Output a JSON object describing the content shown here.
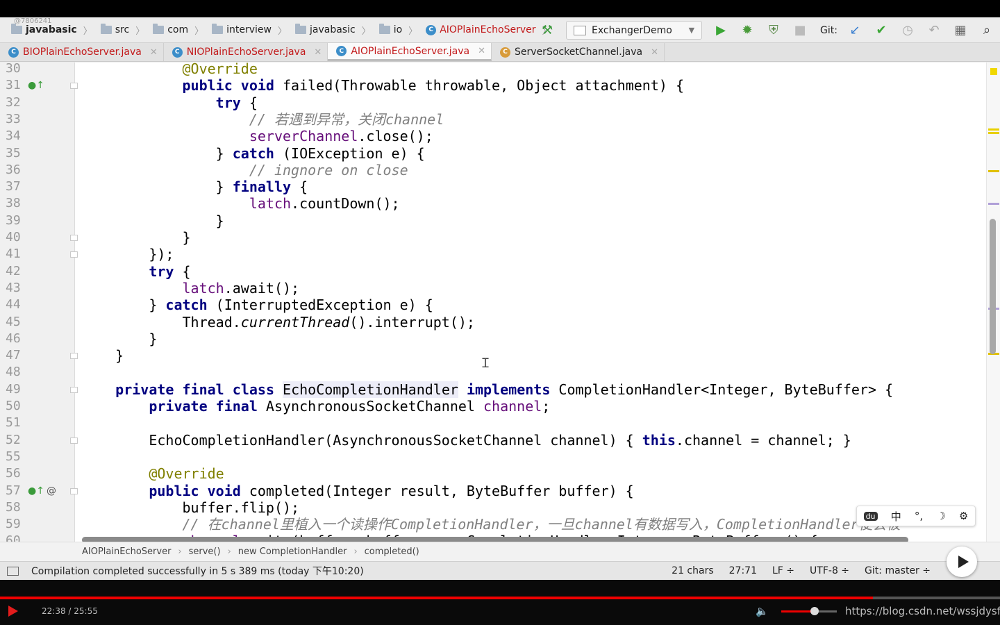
{
  "overlay_id": "@7806241",
  "nav": {
    "crumbs": [
      {
        "label": "javabasic",
        "bold": true
      },
      {
        "label": "src"
      },
      {
        "label": "com"
      },
      {
        "label": "interview"
      },
      {
        "label": "javabasic"
      },
      {
        "label": "io"
      },
      {
        "label": "AIOPlainEchoServer",
        "is_class": true
      }
    ],
    "run_config": "ExchangerDemo",
    "git_label": "Git:"
  },
  "tabs": [
    {
      "label": "BIOPlainEchoServer.java",
      "active": false
    },
    {
      "label": "NIOPlainEchoServer.java",
      "active": false
    },
    {
      "label": "AIOPlainEchoServer.java",
      "active": true
    },
    {
      "label": "ServerSocketChannel.java",
      "active": false
    }
  ],
  "code": {
    "line_numbers": [
      "30",
      "31",
      "32",
      "33",
      "34",
      "35",
      "36",
      "37",
      "38",
      "39",
      "40",
      "41",
      "42",
      "43",
      "44",
      "45",
      "46",
      "47",
      "48",
      "49",
      "50",
      "51",
      "52",
      "55",
      "56",
      "57",
      "58",
      "59",
      "60"
    ],
    "lines": [
      "            @Override",
      "            public void failed(Throwable throwable, Object attachment) {",
      "                try {",
      "                    // 若遇到异常，关闭channel",
      "                    serverChannel.close();",
      "                } catch (IOException e) {",
      "                    // ingnore on close",
      "                } finally {",
      "                    latch.countDown();",
      "                }",
      "            }",
      "        });",
      "        try {",
      "            latch.await();",
      "        } catch (InterruptedException e) {",
      "            Thread.currentThread().interrupt();",
      "        }",
      "    }",
      "",
      "    private final class EchoCompletionHandler implements CompletionHandler<Integer, ByteBuffer> {",
      "        private final AsynchronousSocketChannel channel;",
      "",
      "        EchoCompletionHandler(AsynchronousSocketChannel channel) { this.channel = channel; }",
      "",
      "        @Override",
      "        public void completed(Integer result, ByteBuffer buffer) {",
      "            buffer.flip();",
      "            // 在channel里植入一个读操作CompletionHandler，一旦channel有数据写入，CompletionHandler便会被",
      "            channel.write(buffer, buffer, new CompletionHandler<Integer, ByteBuffer>() {"
    ]
  },
  "ime": {
    "items": [
      "du",
      "中",
      "°,",
      "☽",
      "⚙"
    ]
  },
  "breadcrumb": [
    "AIOPlainEchoServer",
    "serve()",
    "new CompletionHandler",
    "completed()"
  ],
  "status": {
    "message": "Compilation completed successfully in 5 s 389 ms (today 下午10:20)",
    "chars": "21 chars",
    "position": "27:71",
    "line_sep": "LF ÷",
    "encoding": "UTF-8 ÷",
    "git_branch": "Git: master ÷"
  },
  "player": {
    "time": "22:38 / 25:55",
    "progress": 0.873,
    "volume": 0.6,
    "watermark": "https://blog.csdn.net/wssjdysf1"
  },
  "colors": {
    "keyword": "#000080",
    "comment": "#808080",
    "field": "#660e7a",
    "annotation": "#808000",
    "class_tab": "#c2191a",
    "progress": "#e00000"
  }
}
